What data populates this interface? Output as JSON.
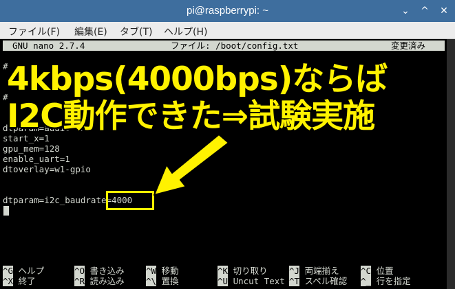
{
  "window": {
    "title": "pi@raspberrypi: ~",
    "min_label": "⌄",
    "max_label": "^",
    "close_label": "✕"
  },
  "menu": [
    "ファイル(F)",
    "編集(E)",
    "タブ(T)",
    "ヘルプ(H)"
  ],
  "nano": {
    "version": "GNU nano 2.7.4",
    "file": "ファイル: /boot/config.txt",
    "state": "変更済み"
  },
  "lines": [
    "# ",
    "",
    "# ",
    "",
    "dtparam=audio=on",
    "start_x=1",
    "gpu_mem=128",
    "enable_uart=1",
    "dtoverlay=w1-gpio",
    "",
    "",
    "dtparam=i2c_baudrate=4000"
  ],
  "shortcuts_row1": [
    {
      "key": "^G",
      "label": "ヘルプ"
    },
    {
      "key": "^O",
      "label": "書き込み"
    },
    {
      "key": "^W",
      "label": "移動"
    },
    {
      "key": "^K",
      "label": "切り取り"
    },
    {
      "key": "^J",
      "label": "両端揃え"
    },
    {
      "key": "^C",
      "label": "位置"
    }
  ],
  "shortcuts_row2": [
    {
      "key": "^X",
      "label": "終了"
    },
    {
      "key": "^R",
      "label": "読み込み"
    },
    {
      "key": "^\\",
      "label": "置換"
    },
    {
      "key": "^U",
      "label": "Uncut Text"
    },
    {
      "key": "^T",
      "label": "スペル確認"
    },
    {
      "key": "^_",
      "label": "行を指定"
    }
  ],
  "overlay": {
    "line1": "4kbps(4000bps)ならば",
    "line2": "I2C動作できた⇒試験実施",
    "color": "#fff200"
  }
}
